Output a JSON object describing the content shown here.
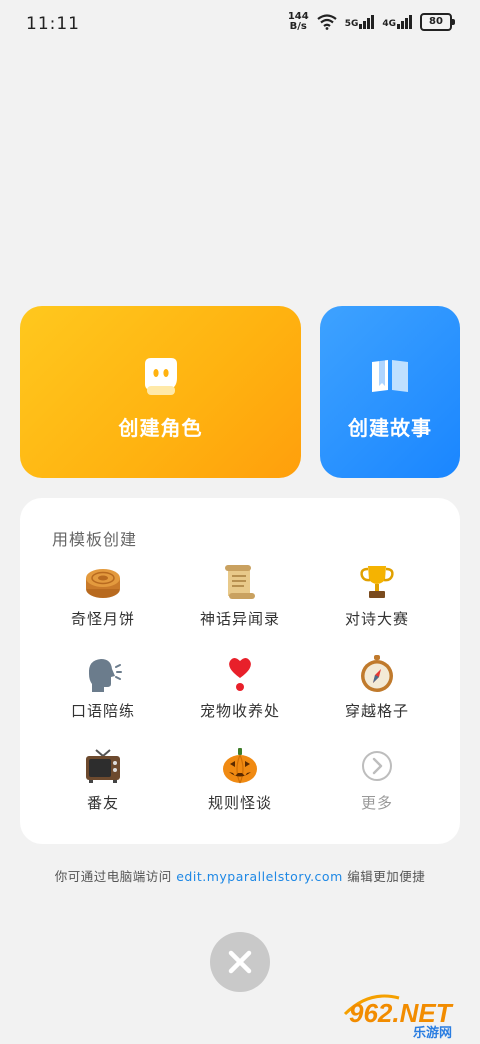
{
  "status_bar": {
    "time": "11:11",
    "net_speed_value": "144",
    "net_speed_unit": "B/s",
    "sim1": "5G",
    "sim2": "4G",
    "battery": "80"
  },
  "cards": {
    "create_character": "创建角色",
    "create_story": "创建故事"
  },
  "templates": {
    "title": "用模板创建",
    "items": [
      {
        "label": "奇怪月饼",
        "icon": "mooncake-icon"
      },
      {
        "label": "神话异闻录",
        "icon": "scroll-icon"
      },
      {
        "label": "对诗大赛",
        "icon": "trophy-icon"
      },
      {
        "label": "口语陪练",
        "icon": "speaking-head-icon"
      },
      {
        "label": "宠物收养处",
        "icon": "heart-exclamation-icon"
      },
      {
        "label": "穿越格子",
        "icon": "compass-icon"
      },
      {
        "label": "番友",
        "icon": "tv-icon"
      },
      {
        "label": "规则怪谈",
        "icon": "jack-o-lantern-icon"
      },
      {
        "label": "更多",
        "icon": "chevron-right-icon"
      }
    ]
  },
  "hint": {
    "prefix": "你可通过电脑端访问",
    "link": "edit.myparallelstory.com",
    "suffix": "编辑更加便捷"
  },
  "watermark": {
    "brand": "962.NET",
    "sub": "乐游网"
  },
  "colors": {
    "character_card": "#ffb210",
    "story_card": "#1a86ff",
    "link": "#1e88e5"
  }
}
